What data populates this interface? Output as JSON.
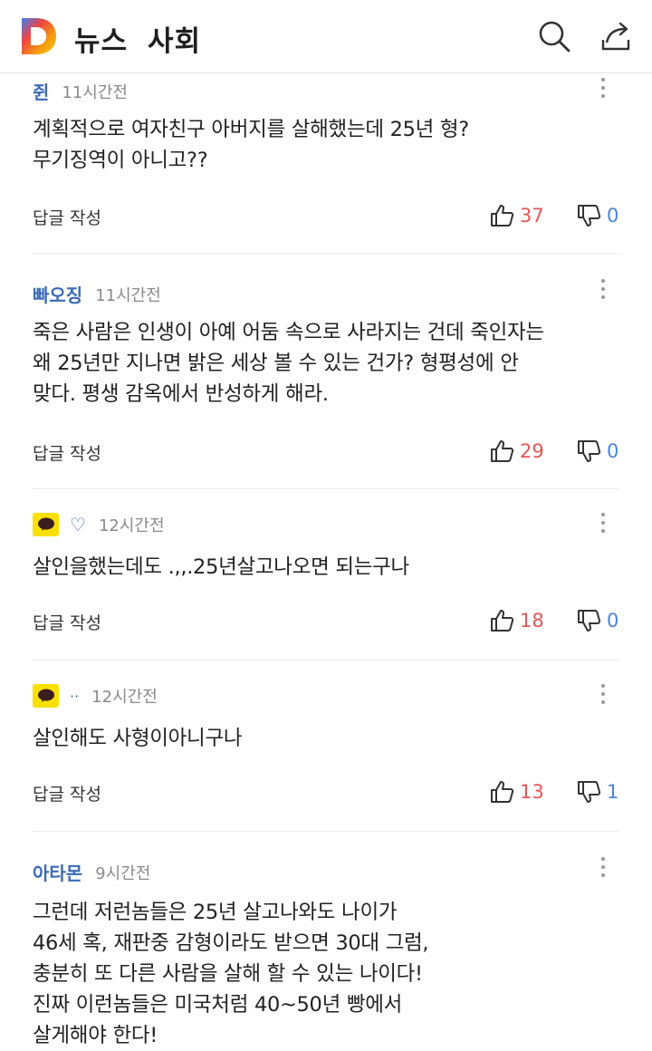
{
  "header": {
    "logo_letter": "D",
    "section": "뉴스",
    "category": "사회",
    "icons": [
      "search-icon",
      "share-icon"
    ]
  },
  "colors": {
    "nickname": "#3a6ab5",
    "like_count": "#e35757",
    "dislike_count": "#4a86d6",
    "kakao_badge": "#f9e000"
  },
  "comments": [
    {
      "nickname": "쥔",
      "time": "11시간전",
      "text": "계획적으로 여자친구 아버지를 살해했는데 25년 형?\n무기징역이 아니고??",
      "reply_label": "답글 작성",
      "likes": "37",
      "dislikes": "0"
    },
    {
      "nickname": "빠오징",
      "time": "11시간전",
      "text": "죽은  사람은  인생이  아예 어둠 속으로 사라지는 건데   죽인자는\n왜 25년만 지나면  밝은 세상  볼 수 있는 건가?   형평성에  안\n맞다.  평생 감옥에서  반성하게  해라.",
      "reply_label": "답글 작성",
      "likes": "29",
      "dislikes": "0"
    },
    {
      "nickname": "♡",
      "time": "12시간전",
      "text": "살인을했는데도 .,,.25년살고나오면 되는구나",
      "reply_label": "답글 작성",
      "likes": "18",
      "dislikes": "0",
      "badge": "kakao-talk-icon"
    },
    {
      "nickname": "··",
      "time": "12시간전",
      "text": "살인해도 사형이아니구나",
      "reply_label": "답글 작성",
      "likes": "13",
      "dislikes": "1",
      "badge": "kakao-talk-icon"
    },
    {
      "nickname": "아타몬",
      "time": "9시간전",
      "text": "그런데 저런놈들은 25년 살고나와도 나이가\n46세 혹,  재판중 감형이라도 받으면 30대 그럼,\n충분히 또 다른 사람을 살해 할 수 있는 나이다!\n진짜 이런놈들은 미국처럼 40~50년 빵에서\n살게해야 한다!"
    }
  ]
}
